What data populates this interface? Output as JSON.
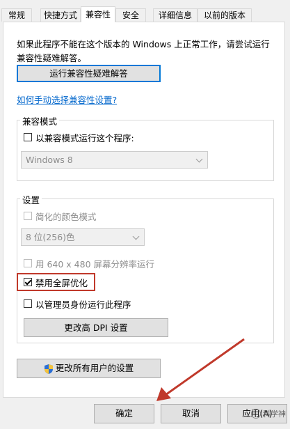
{
  "tabs": [
    "常规",
    "快捷方式",
    "兼容性",
    "安全",
    "详细信息",
    "以前的版本"
  ],
  "active_tab": "兼容性",
  "description": "如果此程序不能在这个版本的 Windows 上正常工作，请尝试运行兼容性疑难解答。",
  "troubleshoot_button": "运行兼容性疑难解答",
  "manual_link": "如何手动选择兼容性设置?",
  "compat_mode": {
    "title": "兼容模式",
    "checkbox_label": "以兼容模式运行这个程序:",
    "checked": false,
    "os_select": "Windows 8"
  },
  "settings": {
    "title": "设置",
    "reduced_color_label": "简化的颜色模式",
    "reduced_color_checked": false,
    "color_select": "8 位(256)色",
    "res_640_label": "用 640 x 480 屏幕分辨率运行",
    "res_640_checked": false,
    "disable_fullscreen_label": "禁用全屏优化",
    "disable_fullscreen_checked": true,
    "run_as_admin_label": "以管理员身份运行此程序",
    "run_as_admin_checked": false,
    "dpi_button": "更改高 DPI 设置"
  },
  "all_users_button": "更改所有用户的设置",
  "footer": {
    "ok": "确定",
    "cancel": "取消",
    "apply": "应用(A)"
  },
  "watermark": "科学神"
}
